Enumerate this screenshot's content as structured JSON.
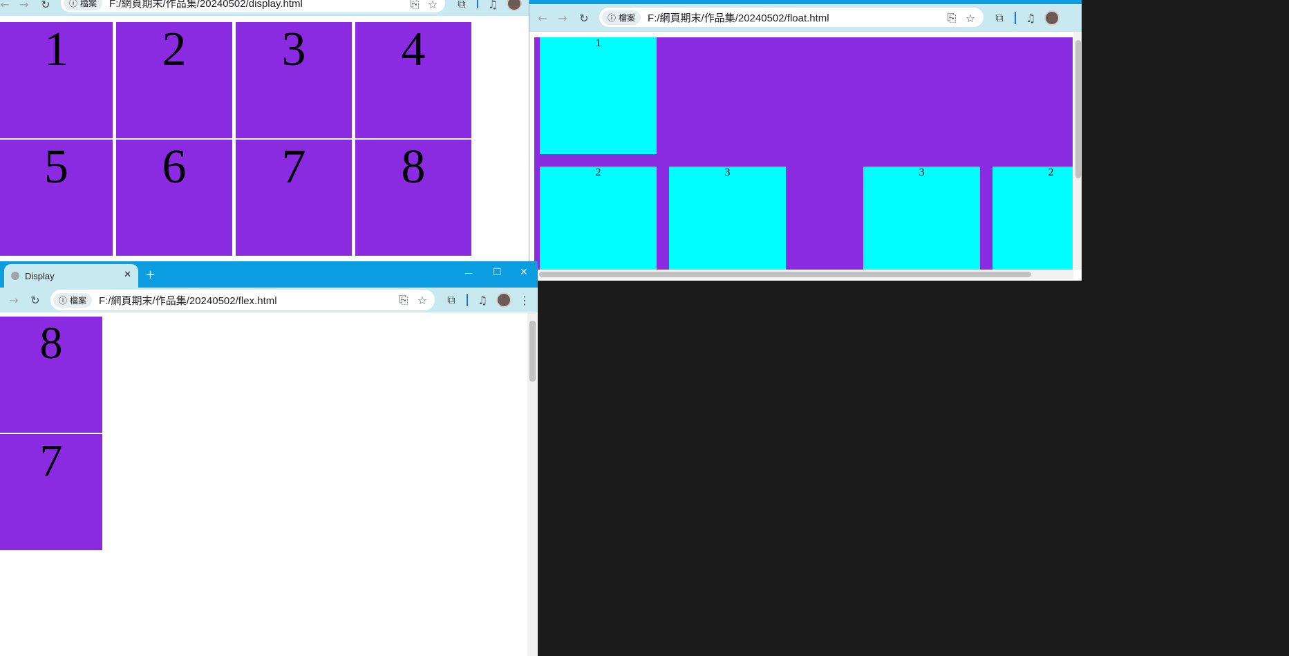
{
  "common": {
    "info_label": "檔案",
    "icon_back": "←",
    "icon_forward": "→",
    "icon_reload": "↻",
    "icon_translate": "⎘",
    "icon_star": "☆",
    "icon_extensions": "⧉",
    "icon_media": "♫",
    "icon_menu": "⋮",
    "icon_info": "ⓘ"
  },
  "colors": {
    "box_purple": "#8a2be2",
    "box_cyan": "#00ffff",
    "chrome_toolbar": "#c9e9f0",
    "tabstrip": "#0c9de1"
  },
  "display_window": {
    "url": "F:/網頁期末/作品集/20240502/display.html",
    "cells": [
      "1",
      "2",
      "3",
      "4",
      "5",
      "6",
      "7",
      "8"
    ]
  },
  "float_window": {
    "url": "F:/網頁期末/作品集/20240502/float.html",
    "boxes": [
      "1",
      "2",
      "3",
      "3",
      "2"
    ]
  },
  "flex_window": {
    "tab_title": "Display",
    "tab_close": "✕",
    "new_tab": "+",
    "minimize": "—",
    "maximize": "☐",
    "url": "F:/網頁期末/作品集/20240502/flex.html",
    "cells": [
      "8",
      "7"
    ]
  }
}
